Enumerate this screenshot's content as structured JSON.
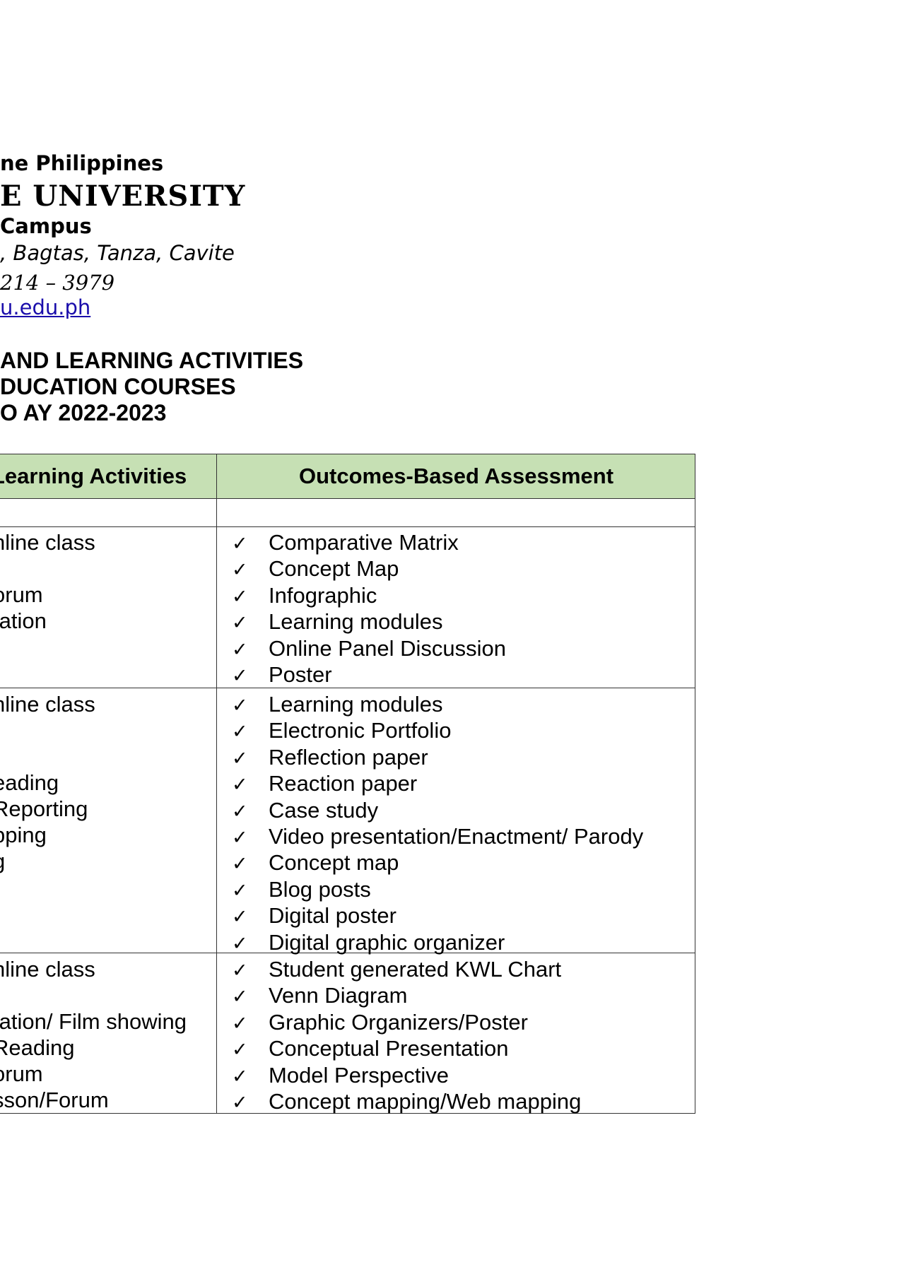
{
  "letterhead": {
    "country": "ne Philippines",
    "university": "E UNIVERSITY",
    "campus": "Campus",
    "address": ", Bagtas, Tanza, Cavite",
    "phone": "214 – 3979",
    "website": "u.edu.ph"
  },
  "titles": [
    "AND LEARNING ACTIVITIES",
    "DUCATION COURSES",
    "O AY 2022-2023"
  ],
  "table": {
    "headers": {
      "left": "Learning Activities",
      "right": "Outcomes-Based Assessment"
    },
    "check_glyph": "✓",
    "rows": [
      {
        "left": [
          "nline class",
          "",
          "orum",
          "tation"
        ],
        "right": [
          "Comparative Matrix",
          "Concept Map",
          "Infographic",
          "Learning modules",
          "Online Panel Discussion",
          "Poster"
        ]
      },
      {
        "left": [
          "nline class",
          "",
          "",
          "eading",
          "Reporting",
          "pping",
          "g"
        ],
        "right": [
          "Learning modules",
          "Electronic Portfolio",
          "Reflection paper",
          "Reaction paper",
          "Case study",
          "Video presentation/Enactment/ Parody",
          "Concept map",
          "Blog posts",
          "Digital poster",
          "Digital graphic organizer"
        ]
      },
      {
        "left": [
          "nline class",
          "",
          "tation/ Film showing",
          " Reading",
          "orum",
          "sson/Forum"
        ],
        "right": [
          "Student generated KWL Chart",
          "Venn Diagram",
          "Graphic Organizers/Poster",
          "Conceptual Presentation",
          "Model Perspective",
          "Concept mapping/Web mapping"
        ]
      }
    ]
  }
}
